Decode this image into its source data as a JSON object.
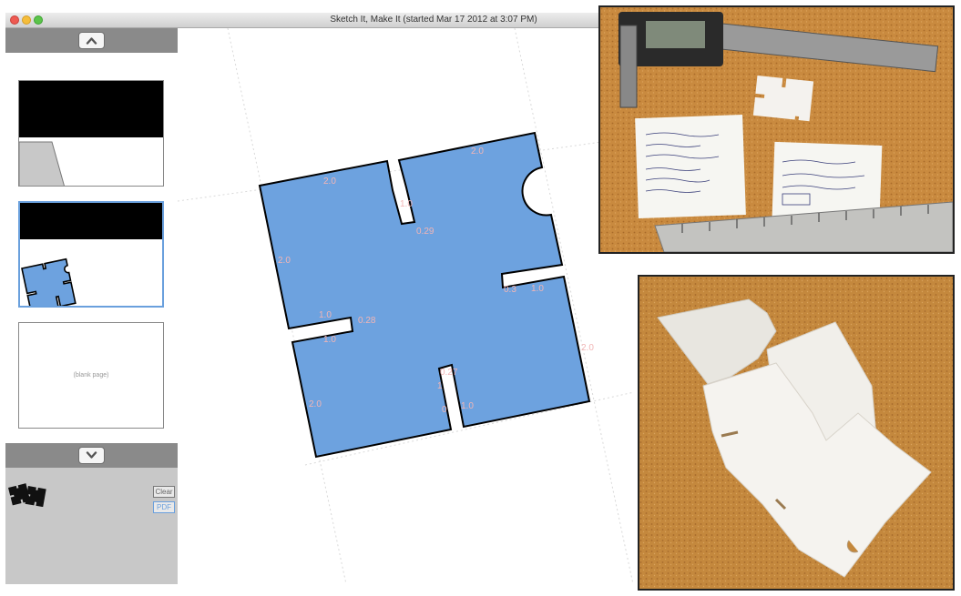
{
  "window": {
    "title": "Sketch It, Make It (started Mar 17 2012 at 3:07 PM)"
  },
  "sidebar": {
    "up_button_icon": "chevron-up-icon",
    "down_button_icon": "chevron-down-icon",
    "blank_page_label": "(blank page)",
    "clear_label": "Clear",
    "pdf_label": "PDF"
  },
  "canvas": {
    "dimension_labels": [
      "2.0",
      "2.0",
      "1.0",
      "0.29",
      "2.0",
      "0.3",
      "1.0",
      "1.0",
      "0.28",
      "1.0",
      "2.0",
      "0.27",
      "1",
      "0",
      "1.0",
      "2.0"
    ]
  },
  "photos": {
    "top_right_description": "caliper-and-notes-photo",
    "bottom_right_description": "assembled-white-acrylic-pieces-photo"
  },
  "colors": {
    "shape_fill": "#6da2df",
    "selection_blue": "#6aa0dd",
    "dimension_pink": "#f2b5b5"
  }
}
